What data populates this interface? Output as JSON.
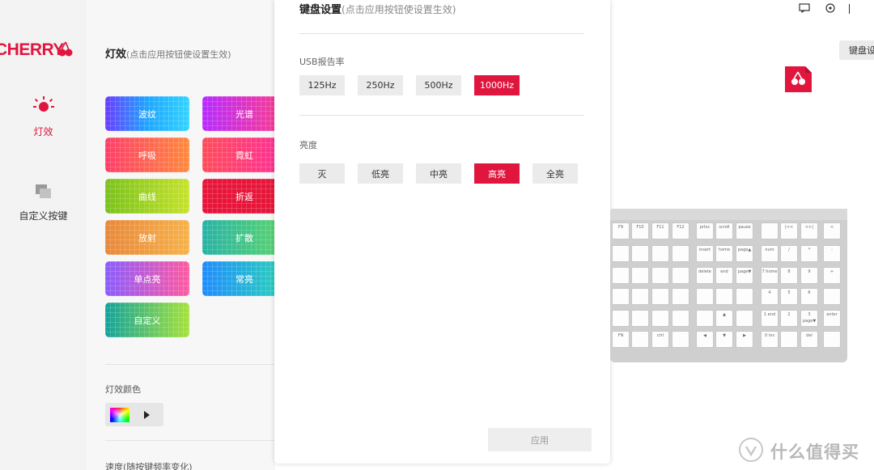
{
  "nav": {
    "logo": "CHERRY",
    "items": [
      {
        "label": "灯效"
      },
      {
        "label": "自定义按键"
      }
    ]
  },
  "panel": {
    "title": "灯效",
    "title_hint": "(点击应用按钮使设置生效)",
    "effects": [
      {
        "label": "波纹"
      },
      {
        "label": "光谱"
      },
      {
        "label": "呼吸"
      },
      {
        "label": "霓虹"
      },
      {
        "label": "曲线"
      },
      {
        "label": "折返"
      },
      {
        "label": "放射"
      },
      {
        "label": "扩散"
      },
      {
        "label": "单点亮"
      },
      {
        "label": "常亮"
      },
      {
        "label": "自定义"
      }
    ],
    "color_label": "灯效颜色",
    "speed_label": "速度(随按键频率变化)"
  },
  "dialog": {
    "title": "键盘设置",
    "title_hint": "(点击应用按钮使设置生效)",
    "usb_label": "USB报告率",
    "usb_options": [
      "125Hz",
      "250Hz",
      "500Hz",
      "1000Hz"
    ],
    "usb_selected": "1000Hz",
    "brightness_label": "亮度",
    "brightness_options": [
      "灭",
      "低亮",
      "中亮",
      "高亮",
      "全亮"
    ],
    "brightness_selected": "高亮",
    "apply_label": "应用"
  },
  "right": {
    "settings_button": "键盘设置",
    "watermark": "什么值得买"
  },
  "keyboard": {
    "rows": [
      [
        "F9",
        "F10",
        "F11",
        "F12",
        "prtsc",
        "scroll",
        "pause",
        "",
        "|<<",
        ">>|",
        "<"
      ],
      [
        "",
        "",
        "",
        "",
        "insert",
        "home",
        "page▲",
        "num",
        "/",
        "*",
        "-"
      ],
      [
        "",
        "",
        "",
        "",
        "delete",
        "end",
        "page▼",
        "7 home",
        "8",
        "9",
        "+"
      ],
      [
        "",
        "",
        "",
        "",
        "",
        "",
        "",
        "4",
        "5",
        "6",
        ""
      ],
      [
        "",
        "",
        "",
        "",
        "",
        "▲",
        "",
        "1 end",
        "2",
        "3 page▼",
        "enter"
      ],
      [
        "FN",
        "",
        "ctrl",
        "",
        "◀",
        "▼",
        "▶",
        "0 ins",
        "",
        "del",
        ""
      ]
    ]
  },
  "colors": {
    "accent": "#e0163f",
    "effects": {
      "波纹": "linear-gradient(90deg,#6a3cff,#1ea6ff,#32d4ff)",
      "光谱": "linear-gradient(90deg,#b62bff,#ff3d8a)",
      "呼吸": "linear-gradient(90deg,#ff3d6a,#ff8a3d)",
      "霓虹": "linear-gradient(90deg,#ff4d5a,#ff2e9a)",
      "曲线": "linear-gradient(90deg,#7ac21b,#c6e22b)",
      "折返": "linear-gradient(90deg,#e8153a,#e8153a)",
      "放射": "linear-gradient(90deg,#e8883a,#f6b24a)",
      "扩散": "linear-gradient(90deg,#28b2a6,#5ed66b)",
      "单点亮": "linear-gradient(90deg,#8a5cff,#ff5aa0)",
      "常亮": "linear-gradient(90deg,#1f8cff,#2ad6b6)",
      "自定义": "linear-gradient(90deg,#13a39b,#a6e23a)"
    }
  }
}
